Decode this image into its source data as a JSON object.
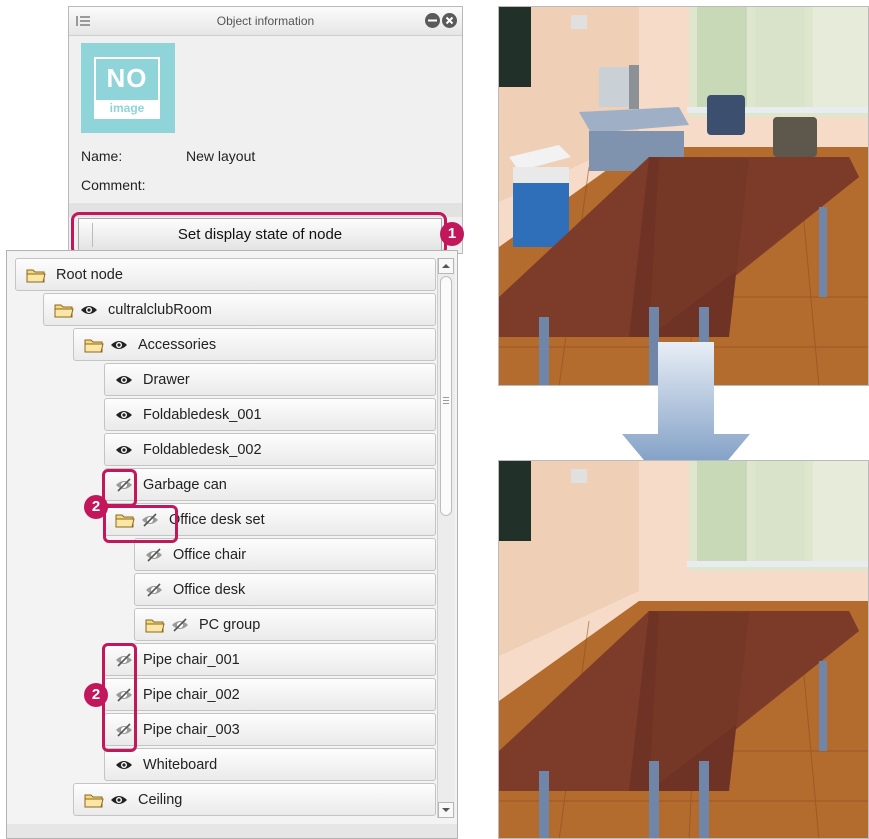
{
  "object_info": {
    "title": "Object information",
    "thumbnail": {
      "line1": "NO",
      "line2": "image"
    },
    "name_label": "Name:",
    "name_value": "New layout",
    "comment_label": "Comment:",
    "set_display_button": "Set display state of node"
  },
  "callouts": [
    "1",
    "2",
    "2"
  ],
  "tree": {
    "nodes": [
      {
        "label": "Root node",
        "icons": [
          "folder-icon"
        ]
      },
      {
        "label": "cultralclubRoom",
        "icons": [
          "folder-icon",
          "eye-icon"
        ]
      },
      {
        "label": "Accessories",
        "icons": [
          "folder-icon",
          "eye-icon"
        ]
      },
      {
        "label": "Drawer",
        "icons": [
          "eye-icon"
        ]
      },
      {
        "label": "Foldabledesk_001",
        "icons": [
          "eye-icon"
        ]
      },
      {
        "label": "Foldabledesk_002",
        "icons": [
          "eye-icon"
        ]
      },
      {
        "label": "Garbage can",
        "icons": [
          "eye-off-icon"
        ]
      },
      {
        "label": "Office desk set",
        "icons": [
          "folder-icon",
          "eye-off-icon"
        ]
      },
      {
        "label": "Office chair",
        "icons": [
          "eye-off-icon"
        ]
      },
      {
        "label": "Office desk",
        "icons": [
          "eye-off-icon"
        ]
      },
      {
        "label": "PC group",
        "icons": [
          "folder-icon",
          "eye-off-icon"
        ]
      },
      {
        "label": "Pipe chair_001",
        "icons": [
          "eye-off-icon"
        ]
      },
      {
        "label": "Pipe chair_002",
        "icons": [
          "eye-off-icon"
        ]
      },
      {
        "label": "Pipe chair_003",
        "icons": [
          "eye-off-icon"
        ]
      },
      {
        "label": "Whiteboard",
        "icons": [
          "eye-icon"
        ]
      },
      {
        "label": "Ceiling",
        "icons": [
          "folder-icon",
          "eye-icon"
        ]
      }
    ]
  },
  "colors": {
    "highlight": "#c2185b",
    "arrow": "#5b82b3",
    "thumbnail": "#8fd4d8"
  }
}
